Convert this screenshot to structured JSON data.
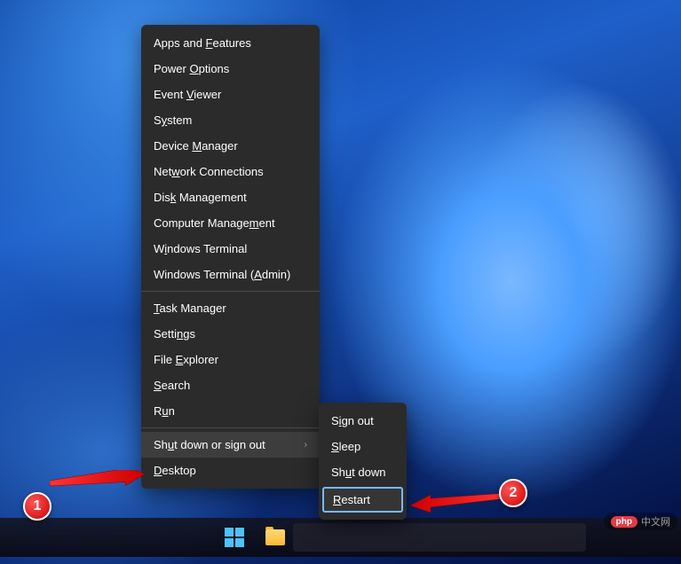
{
  "menu": {
    "items": [
      {
        "label": "Apps and Features",
        "accel_idx": 9
      },
      {
        "label": "Power Options",
        "accel_idx": 6
      },
      {
        "label": "Event Viewer",
        "accel_idx": 6
      },
      {
        "label": "System",
        "accel_idx": 1
      },
      {
        "label": "Device Manager",
        "accel_idx": 7
      },
      {
        "label": "Network Connections",
        "accel_idx": 3
      },
      {
        "label": "Disk Management",
        "accel_idx": 3
      },
      {
        "label": "Computer Management",
        "accel_idx": 15
      },
      {
        "label": "Windows Terminal",
        "accel_idx": 1
      },
      {
        "label": "Windows Terminal (Admin)",
        "accel_idx": 18
      },
      {
        "separator": true
      },
      {
        "label": "Task Manager",
        "accel_idx": 0
      },
      {
        "label": "Settings",
        "accel_idx": 5
      },
      {
        "label": "File Explorer",
        "accel_idx": 5
      },
      {
        "label": "Search",
        "accel_idx": 0
      },
      {
        "label": "Run",
        "accel_idx": 1
      },
      {
        "separator": true
      },
      {
        "label": "Shut down or sign out",
        "accel_idx": 2,
        "submenu": true,
        "highlighted": true
      },
      {
        "label": "Desktop",
        "accel_idx": 0
      }
    ]
  },
  "submenu": {
    "items": [
      {
        "label": "Sign out",
        "accel_idx": 1
      },
      {
        "label": "Sleep",
        "accel_idx": 0
      },
      {
        "label": "Shut down",
        "accel_idx": 2
      },
      {
        "label": "Restart",
        "accel_idx": 0,
        "selected": true
      }
    ]
  },
  "annotations": {
    "badge1": "1",
    "badge2": "2"
  },
  "watermark": {
    "logo": "php",
    "text": "中文网"
  }
}
